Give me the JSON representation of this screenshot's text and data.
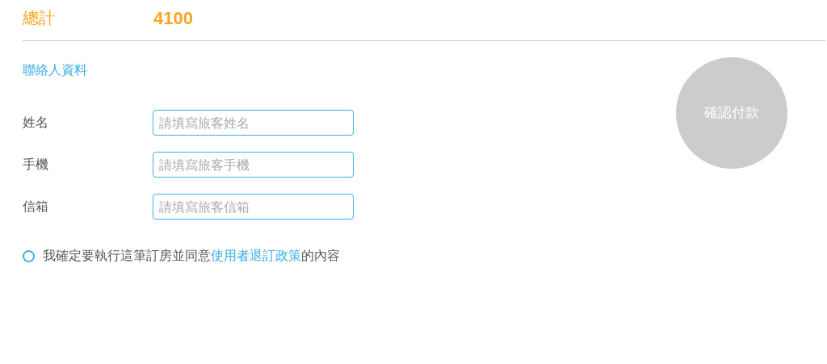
{
  "total": {
    "label": "總計",
    "value": "4100"
  },
  "contact": {
    "title": "聯絡人資料",
    "fields": [
      {
        "label": "姓名",
        "placeholder": "請填寫旅客姓名"
      },
      {
        "label": "手機",
        "placeholder": "請填寫旅客手機"
      },
      {
        "label": "信箱",
        "placeholder": "請填寫旅客信箱"
      }
    ]
  },
  "agreement": {
    "checked": false,
    "text_before": "我確定要執行這筆訂房並同意",
    "link": "使用者退訂政策",
    "text_after": "的內容"
  },
  "pay_button": {
    "label": "確認付款",
    "disabled": true
  }
}
